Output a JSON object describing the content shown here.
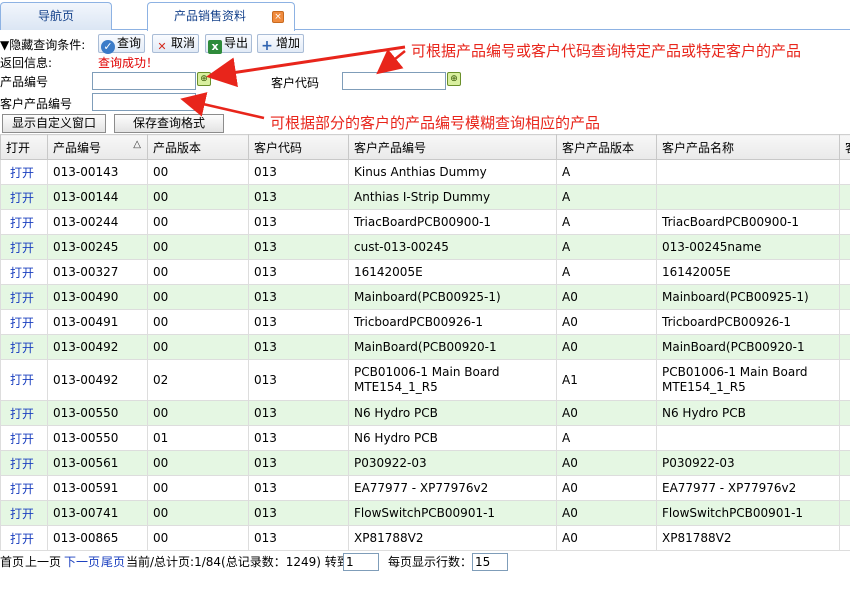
{
  "tabs": [
    {
      "label": "导航页"
    },
    {
      "label": "产品销售资料",
      "close": "×"
    }
  ],
  "toolbar": {
    "toggle_label": "▼隐藏查询条件:",
    "search": "查询",
    "cancel": "取消",
    "export": "导出",
    "add": "增加"
  },
  "info": {
    "label": "返回信息:",
    "message": "查询成功！"
  },
  "fields": {
    "product_no": {
      "label": "产品编号",
      "value": ""
    },
    "customer_code": {
      "label": "客户代码",
      "value": ""
    },
    "customer_product_no": {
      "label": "客户产品编号",
      "value": ""
    }
  },
  "buttons": {
    "custom_window": "显示自定义窗口",
    "save_format": "保存查询格式"
  },
  "annotations": {
    "top": "可根据产品编号或客户代码查询特定产品或特定客户的产品",
    "bottom": "可根据部分的客户的产品编号模糊查询相应的产品"
  },
  "colors": {
    "annotation": "#e8251b",
    "alt_row": "#e5f7e3",
    "link": "#1a3fbf",
    "success": "#e00000"
  },
  "table": {
    "columns": [
      "打开",
      "产品编号",
      "产品版本",
      "客户代码",
      "客户产品编号",
      "客户产品版本",
      "客户产品名称",
      "客"
    ],
    "sort_indicator": "△",
    "rows": [
      {
        "open": "打开",
        "product_no": "013-00143",
        "version": "00",
        "customer": "013",
        "cust_product_no": "Kinus Anthias Dummy",
        "cust_version": "A",
        "cust_name": ""
      },
      {
        "open": "打开",
        "product_no": "013-00144",
        "version": "00",
        "customer": "013",
        "cust_product_no": "Anthias I-Strip Dummy",
        "cust_version": "A",
        "cust_name": ""
      },
      {
        "open": "打开",
        "product_no": "013-00244",
        "version": "00",
        "customer": "013",
        "cust_product_no": "TriacBoardPCB00900-1",
        "cust_version": "A",
        "cust_name": "TriacBoardPCB00900-1"
      },
      {
        "open": "打开",
        "product_no": "013-00245",
        "version": "00",
        "customer": "013",
        "cust_product_no": "cust-013-00245",
        "cust_version": "A",
        "cust_name": "013-00245name"
      },
      {
        "open": "打开",
        "product_no": "013-00327",
        "version": "00",
        "customer": "013",
        "cust_product_no": "16142005E",
        "cust_version": "A",
        "cust_name": "16142005E"
      },
      {
        "open": "打开",
        "product_no": "013-00490",
        "version": "00",
        "customer": "013",
        "cust_product_no": "Mainboard(PCB00925-1)",
        "cust_version": "A0",
        "cust_name": "Mainboard(PCB00925-1)"
      },
      {
        "open": "打开",
        "product_no": "013-00491",
        "version": "00",
        "customer": "013",
        "cust_product_no": "TricboardPCB00926-1",
        "cust_version": "A0",
        "cust_name": "TricboardPCB00926-1"
      },
      {
        "open": "打开",
        "product_no": "013-00492",
        "version": "00",
        "customer": "013",
        "cust_product_no": "MainBoard(PCB00920-1",
        "cust_version": "A0",
        "cust_name": "MainBoard(PCB00920-1"
      },
      {
        "open": "打开",
        "product_no": "013-00492",
        "version": "02",
        "customer": "013",
        "cust_product_no": "PCB01006-1 Main Board MTE154_1_R5",
        "cust_version": "A1",
        "cust_name": "PCB01006-1 Main Board MTE154_1_R5"
      },
      {
        "open": "打开",
        "product_no": "013-00550",
        "version": "00",
        "customer": "013",
        "cust_product_no": "N6 Hydro PCB",
        "cust_version": "A0",
        "cust_name": "N6 Hydro PCB"
      },
      {
        "open": "打开",
        "product_no": "013-00550",
        "version": "01",
        "customer": "013",
        "cust_product_no": "N6 Hydro PCB",
        "cust_version": "A",
        "cust_name": ""
      },
      {
        "open": "打开",
        "product_no": "013-00561",
        "version": "00",
        "customer": "013",
        "cust_product_no": "P030922-03",
        "cust_version": "A0",
        "cust_name": "P030922-03"
      },
      {
        "open": "打开",
        "product_no": "013-00591",
        "version": "00",
        "customer": "013",
        "cust_product_no": "EA77977 - XP77976v2",
        "cust_version": "A0",
        "cust_name": "EA77977 - XP77976v2"
      },
      {
        "open": "打开",
        "product_no": "013-00741",
        "version": "00",
        "customer": "013",
        "cust_product_no": "FlowSwitchPCB00901-1",
        "cust_version": "A0",
        "cust_name": "FlowSwitchPCB00901-1"
      },
      {
        "open": "打开",
        "product_no": "013-00865",
        "version": "00",
        "customer": "013",
        "cust_product_no": "XP81788V2",
        "cust_version": "A0",
        "cust_name": "XP81788V2"
      }
    ]
  },
  "pager": {
    "first": "首页",
    "prev": "上一页",
    "next": "下一页",
    "last": "尾页",
    "status": "当前/总计页:1/84(总记录数：1249) 转到",
    "goto_value": "1",
    "per_page_label": "每页显示行数：",
    "per_page_value": "15"
  }
}
